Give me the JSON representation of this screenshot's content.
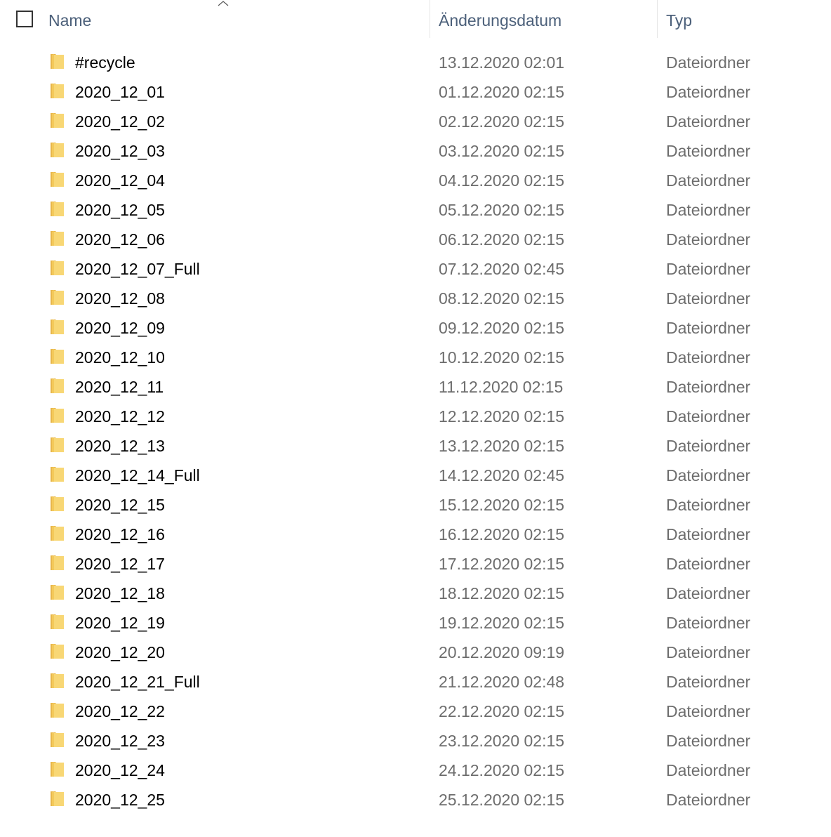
{
  "header": {
    "name_label": "Name",
    "date_label": "Änderungsdatum",
    "type_label": "Typ",
    "sort_icon": "chevron-up-icon"
  },
  "colors": {
    "header_text": "#4c607a",
    "name_text": "#000000",
    "meta_text": "#6d6d6d",
    "folder_yellow": "#f8d775"
  },
  "files": [
    {
      "name": "#recycle",
      "date": "13.12.2020 02:01",
      "type": "Dateiordner",
      "icon": "folder-icon"
    },
    {
      "name": "2020_12_01",
      "date": "01.12.2020 02:15",
      "type": "Dateiordner",
      "icon": "folder-icon"
    },
    {
      "name": "2020_12_02",
      "date": "02.12.2020 02:15",
      "type": "Dateiordner",
      "icon": "folder-icon"
    },
    {
      "name": "2020_12_03",
      "date": "03.12.2020 02:15",
      "type": "Dateiordner",
      "icon": "folder-icon"
    },
    {
      "name": "2020_12_04",
      "date": "04.12.2020 02:15",
      "type": "Dateiordner",
      "icon": "folder-icon"
    },
    {
      "name": "2020_12_05",
      "date": "05.12.2020 02:15",
      "type": "Dateiordner",
      "icon": "folder-icon"
    },
    {
      "name": "2020_12_06",
      "date": "06.12.2020 02:15",
      "type": "Dateiordner",
      "icon": "folder-icon"
    },
    {
      "name": "2020_12_07_Full",
      "date": "07.12.2020 02:45",
      "type": "Dateiordner",
      "icon": "folder-icon"
    },
    {
      "name": "2020_12_08",
      "date": "08.12.2020 02:15",
      "type": "Dateiordner",
      "icon": "folder-icon"
    },
    {
      "name": "2020_12_09",
      "date": "09.12.2020 02:15",
      "type": "Dateiordner",
      "icon": "folder-icon"
    },
    {
      "name": "2020_12_10",
      "date": "10.12.2020 02:15",
      "type": "Dateiordner",
      "icon": "folder-icon"
    },
    {
      "name": "2020_12_11",
      "date": "11.12.2020 02:15",
      "type": "Dateiordner",
      "icon": "folder-icon"
    },
    {
      "name": "2020_12_12",
      "date": "12.12.2020 02:15",
      "type": "Dateiordner",
      "icon": "folder-icon"
    },
    {
      "name": "2020_12_13",
      "date": "13.12.2020 02:15",
      "type": "Dateiordner",
      "icon": "folder-icon"
    },
    {
      "name": "2020_12_14_Full",
      "date": "14.12.2020 02:45",
      "type": "Dateiordner",
      "icon": "folder-icon"
    },
    {
      "name": "2020_12_15",
      "date": "15.12.2020 02:15",
      "type": "Dateiordner",
      "icon": "folder-icon"
    },
    {
      "name": "2020_12_16",
      "date": "16.12.2020 02:15",
      "type": "Dateiordner",
      "icon": "folder-icon"
    },
    {
      "name": "2020_12_17",
      "date": "17.12.2020 02:15",
      "type": "Dateiordner",
      "icon": "folder-icon"
    },
    {
      "name": "2020_12_18",
      "date": "18.12.2020 02:15",
      "type": "Dateiordner",
      "icon": "folder-icon"
    },
    {
      "name": "2020_12_19",
      "date": "19.12.2020 02:15",
      "type": "Dateiordner",
      "icon": "folder-icon"
    },
    {
      "name": "2020_12_20",
      "date": "20.12.2020 09:19",
      "type": "Dateiordner",
      "icon": "folder-icon"
    },
    {
      "name": "2020_12_21_Full",
      "date": "21.12.2020 02:48",
      "type": "Dateiordner",
      "icon": "folder-icon"
    },
    {
      "name": "2020_12_22",
      "date": "22.12.2020 02:15",
      "type": "Dateiordner",
      "icon": "folder-icon"
    },
    {
      "name": "2020_12_23",
      "date": "23.12.2020 02:15",
      "type": "Dateiordner",
      "icon": "folder-icon"
    },
    {
      "name": "2020_12_24",
      "date": "24.12.2020 02:15",
      "type": "Dateiordner",
      "icon": "folder-icon"
    },
    {
      "name": "2020_12_25",
      "date": "25.12.2020 02:15",
      "type": "Dateiordner",
      "icon": "folder-icon"
    }
  ]
}
